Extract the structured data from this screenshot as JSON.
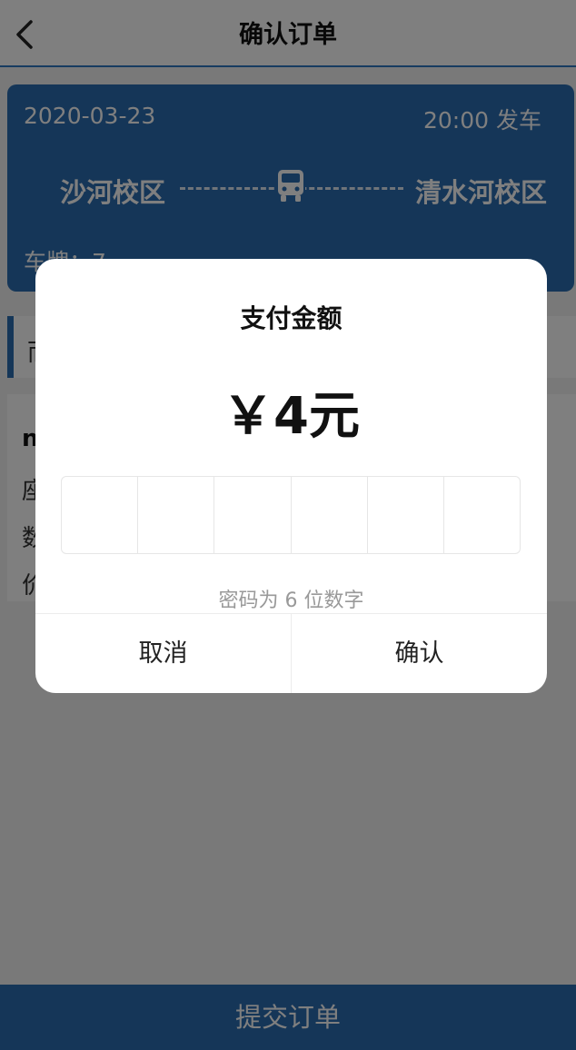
{
  "nav": {
    "title": "确认订单",
    "back_icon": "chevron-left-icon"
  },
  "trip": {
    "date": "2020-03-23",
    "time": "20:00 发车",
    "from": "沙河校区",
    "to": "清水河校区",
    "plate": "车牌：7",
    "bus_icon": "bus-icon"
  },
  "tab": {
    "label": "而"
  },
  "passenger": {
    "name": "n",
    "rows": [
      "座",
      "数",
      "价"
    ]
  },
  "submit": {
    "label": "提交订单"
  },
  "dialog": {
    "title": "支付金额",
    "amount": "￥4元",
    "pin_length": 6,
    "hint": "密码为 6 位数字",
    "cancel_label": "取消",
    "confirm_label": "确认"
  },
  "colors": {
    "accent": "#2b6cb0",
    "mask": "rgba(0,0,0,0.5)"
  }
}
